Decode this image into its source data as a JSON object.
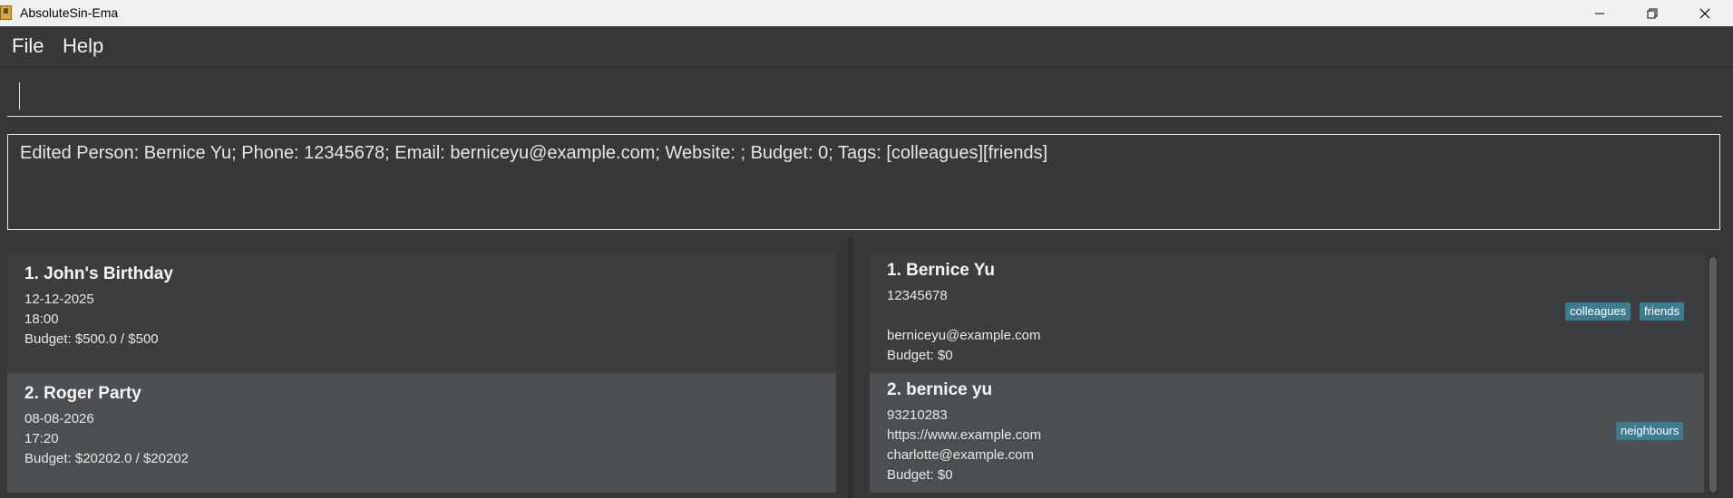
{
  "window": {
    "title": "AbsoluteSin-Ema"
  },
  "menu": {
    "file": "File",
    "help": "Help"
  },
  "command": {
    "value": "",
    "placeholder": ""
  },
  "result": {
    "text": "Edited Person: Bernice Yu; Phone: 12345678; Email: berniceyu@example.com; Website: ; Budget: 0; Tags: [colleagues][friends]"
  },
  "events": [
    {
      "title": "1. John's Birthday",
      "date": "12-12-2025",
      "time": "18:00",
      "budget": "Budget: $500.0 / $500"
    },
    {
      "title": "2. Roger Party",
      "date": "08-08-2026",
      "time": "17:20",
      "budget": "Budget: $20202.0 / $20202"
    }
  ],
  "persons": [
    {
      "title": "1. Bernice Yu",
      "phone": "12345678",
      "website": "",
      "email": "berniceyu@example.com",
      "budget": "Budget: $0",
      "tags": [
        "colleagues",
        "friends"
      ]
    },
    {
      "title": "2. bernice yu",
      "phone": "93210283",
      "website": "https://www.example.com",
      "email": "charlotte@example.com",
      "budget": "Budget: $0",
      "tags": [
        "neighbours"
      ]
    }
  ],
  "colors": {
    "tag_bg": "#3e7b91",
    "background": "#383838"
  }
}
